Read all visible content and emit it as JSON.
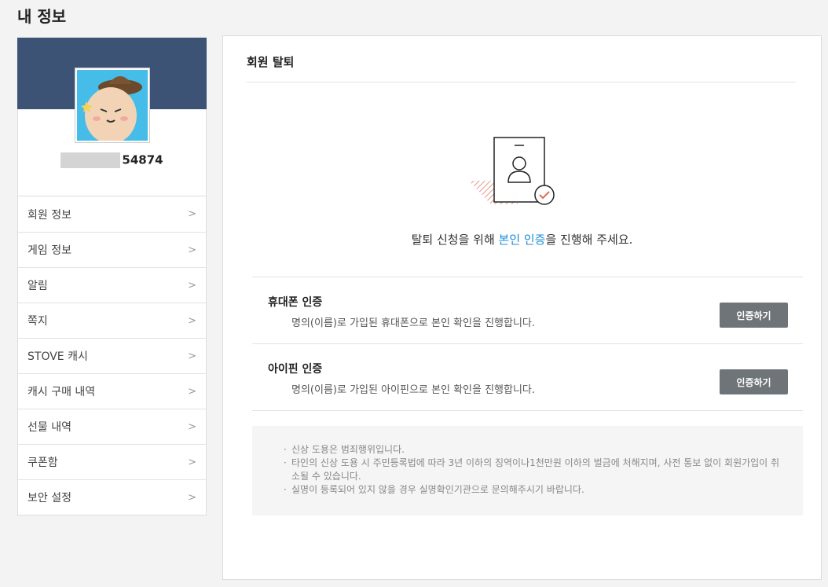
{
  "page": {
    "title": "내 정보"
  },
  "profile": {
    "username_suffix": "54874"
  },
  "sidebar": {
    "items": [
      {
        "label": "회원 정보"
      },
      {
        "label": "게임 정보"
      },
      {
        "label": "알림"
      },
      {
        "label": "쪽지"
      },
      {
        "label": "STOVE 캐시"
      },
      {
        "label": "캐시 구매 내역"
      },
      {
        "label": "선물 내역"
      },
      {
        "label": "쿠폰함"
      },
      {
        "label": "보안 설정"
      }
    ],
    "chevron": ">"
  },
  "main": {
    "title": "회원 탈퇴",
    "message_before": "탈퇴 신청을 위해 ",
    "message_highlight": "본인 인증",
    "message_after": "을 진행해 주세요.",
    "highlight_color": "#1d8dd8",
    "auth_options": [
      {
        "title": "휴대폰 인증",
        "desc": "명의(이름)로 가입된 휴대폰으로 본인 확인을 진행합니다.",
        "button": "인증하기"
      },
      {
        "title": "아이핀 인증",
        "desc": "명의(이름)로 가입된 아이핀으로 본인 확인을 진행합니다.",
        "button": "인증하기"
      }
    ],
    "notices": [
      "신상 도용은 범죄행위입니다.",
      "타인의 신상 도용 시 주민등록법에 따라 3년 이하의 징역이나1천만원 이하의 벌금에 처해지며, 사전 통보 없이 회원가입이 취소될 수 있습니다.",
      "실명이 등록되어 있지 않을 경우 실명확인기관으로 문의해주시기 바랍니다."
    ]
  }
}
